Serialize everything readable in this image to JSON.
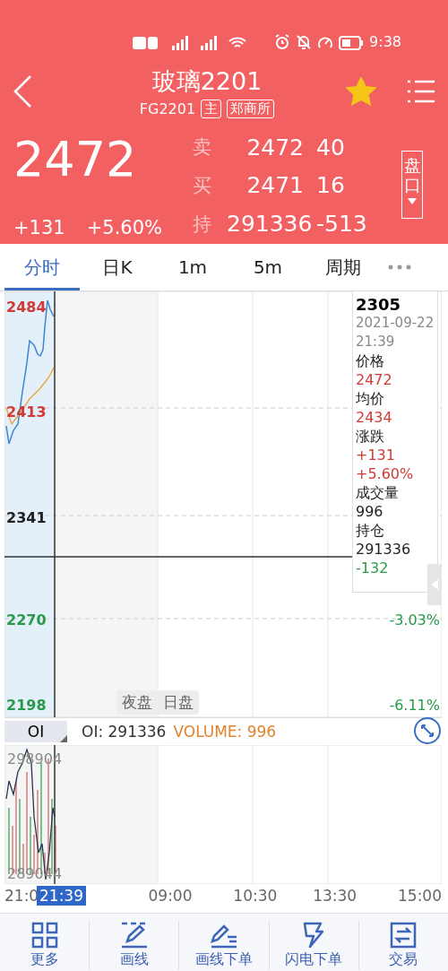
{
  "status_bar": {
    "time": "9:38"
  },
  "header": {
    "title": "玻璃2201",
    "code": "FG2201",
    "tags": [
      "主",
      "郑商所"
    ],
    "favorite": true,
    "price": "2472",
    "change": "+131",
    "change_pct": "+5.60%",
    "panel_toggle": "盘口",
    "quotes": [
      {
        "label": "卖",
        "price": "2472",
        "qty": "40"
      },
      {
        "label": "买",
        "price": "2471",
        "qty": "16"
      },
      {
        "label": "持",
        "price": "291336",
        "qty": "-513"
      }
    ]
  },
  "tabs": [
    {
      "label": "分时",
      "selected": true
    },
    {
      "label": "日K",
      "selected": false
    },
    {
      "label": "1m",
      "selected": false
    },
    {
      "label": "5m",
      "selected": false
    },
    {
      "label": "周期",
      "selected": false
    }
  ],
  "chart": {
    "left_labels": [
      {
        "text": "2484",
        "color": "#d23a36"
      },
      {
        "text": "2413",
        "color": "#d23a36"
      },
      {
        "text": "2341",
        "color": "#222222"
      },
      {
        "text": "2270",
        "color": "#2a9a4a"
      },
      {
        "text": "2198",
        "color": "#2a9a4a"
      }
    ],
    "right_labels": [
      {
        "text": "-3.03%",
        "color": "#2a9a4a"
      },
      {
        "text": "-6.11%",
        "color": "#2a9a4a"
      }
    ],
    "tooltip": {
      "title": "2305",
      "date": "2021-09-22",
      "time": "21:39",
      "lines": [
        {
          "text": "价格",
          "color": "#222222"
        },
        {
          "text": "2472",
          "color": "#d23a36"
        },
        {
          "text": "均价",
          "color": "#222222"
        },
        {
          "text": "2434",
          "color": "#d23a36"
        },
        {
          "text": "涨跌",
          "color": "#222222"
        },
        {
          "text": "+131",
          "color": "#d23a36"
        },
        {
          "text": "+5.60%",
          "color": "#d23a36"
        },
        {
          "text": "成交量",
          "color": "#222222"
        },
        {
          "text": "996",
          "color": "#222222"
        },
        {
          "text": "持仓",
          "color": "#222222"
        },
        {
          "text": "291336",
          "color": "#222222"
        },
        {
          "text": "-132",
          "color": "#2a9a4a"
        }
      ]
    },
    "sessions": [
      {
        "label": "夜盘",
        "selected": false
      },
      {
        "label": "日盘",
        "selected": false
      }
    ]
  },
  "indicator": {
    "selector": "OI",
    "oi": "OI: 291336",
    "volume": "VOLUME: 996",
    "top_label": "298904",
    "bottom_label": "289044"
  },
  "time_axis": {
    "labels": [
      "21:0",
      "09:00",
      "10:30",
      "13:30",
      "15:00"
    ],
    "cursor": "21:39"
  },
  "bottom_nav": [
    {
      "label": "更多",
      "kind": "grid"
    },
    {
      "label": "画线",
      "kind": "pen"
    },
    {
      "label": "画线下单",
      "kind": "pen-lines"
    },
    {
      "label": "闪电下单",
      "kind": "bolt"
    },
    {
      "label": "交易",
      "kind": "swap"
    }
  ]
}
